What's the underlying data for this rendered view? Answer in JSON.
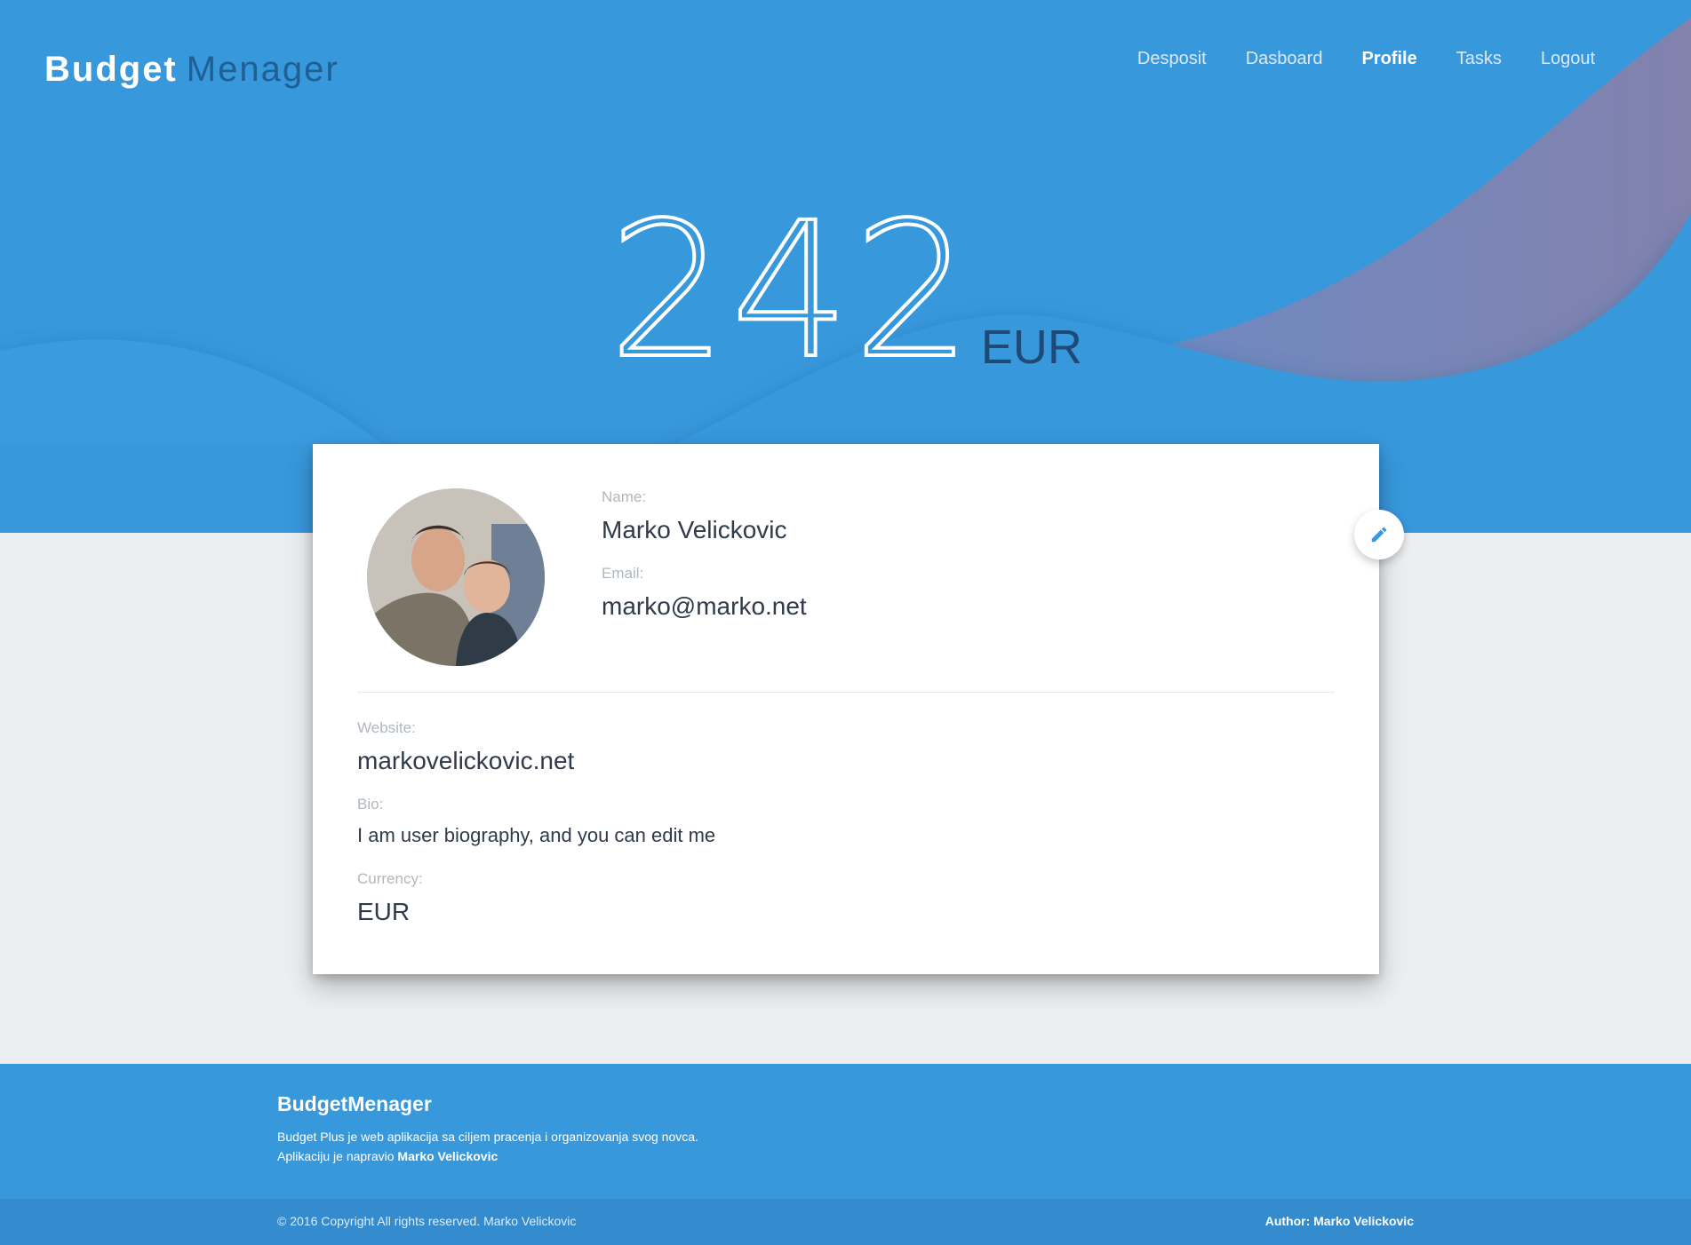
{
  "brand": {
    "bold": "Budget",
    "light": "Menager"
  },
  "nav": [
    {
      "label": "Desposit",
      "active": false
    },
    {
      "label": "Dasboard",
      "active": false
    },
    {
      "label": "Profile",
      "active": true
    },
    {
      "label": "Tasks",
      "active": false
    },
    {
      "label": "Logout",
      "active": false
    }
  ],
  "balance": {
    "amount": "242",
    "currency": "EUR"
  },
  "profile": {
    "name_label": "Name:",
    "name": "Marko Velickovic",
    "email_label": "Email:",
    "email": "marko@marko.net",
    "website_label": "Website:",
    "website": "markovelickovic.net",
    "bio_label": "Bio:",
    "bio": "I am user biography, and you can edit me",
    "currency_label": "Currency:",
    "currency": "EUR",
    "avatar_icon": "user-photo",
    "edit_icon": "pencil-icon"
  },
  "footer": {
    "title": "BudgetMenager",
    "line1": "Budget Plus je web aplikacija sa ciljem pracenja i organizovanja svog novca.",
    "line2_prefix": "Aplikaciju je napravio",
    "line2_author": "Marko Velickovic",
    "copyright": "© 2016 Copyright All rights reserved. Marko Velickovic",
    "author": "Author: Marko Velickovic"
  },
  "colors": {
    "primary": "#3898dc",
    "primary_dark": "#348bcd",
    "background": "#eceff1",
    "wave_purple": "#7d84b0",
    "text_dark": "#2f3b4a"
  }
}
